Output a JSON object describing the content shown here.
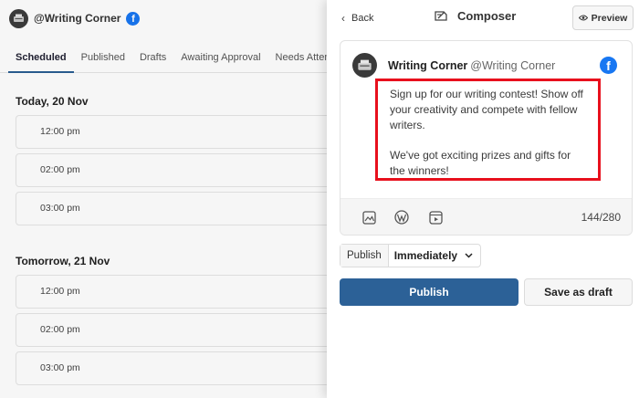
{
  "account": {
    "handle": "@Writing Corner",
    "network_icon": "facebook-icon"
  },
  "tabs": [
    {
      "label": "Scheduled",
      "active": true
    },
    {
      "label": "Published"
    },
    {
      "label": "Drafts"
    },
    {
      "label": "Awaiting Approval"
    },
    {
      "label": "Needs Attention"
    }
  ],
  "days": [
    {
      "title": "Today, 20 Nov",
      "slots": [
        "12:00 pm",
        "02:00 pm",
        "03:00 pm"
      ]
    },
    {
      "title": "Tomorrow, 21 Nov",
      "slots": [
        "12:00 pm",
        "02:00 pm",
        "03:00 pm"
      ]
    }
  ],
  "composer": {
    "back_label": "Back",
    "title": "Composer",
    "preview_label": "Preview",
    "post": {
      "name": "Writing Corner",
      "handle": "@Writing Corner",
      "paragraph1": "Sign up for our writing contest! Show off your creativity and compete with fellow writers.",
      "paragraph2": "We've got exciting prizes and gifts for the winners!",
      "char_count": "144/280",
      "highlight_color": "#e8101d"
    },
    "footer_icons": [
      "image-icon",
      "wordpress-icon",
      "video-icon"
    ],
    "timing": {
      "label": "Publish",
      "value": "Immediately"
    },
    "publish_label": "Publish",
    "draft_label": "Save as draft",
    "accent_color": "#2c6197"
  }
}
